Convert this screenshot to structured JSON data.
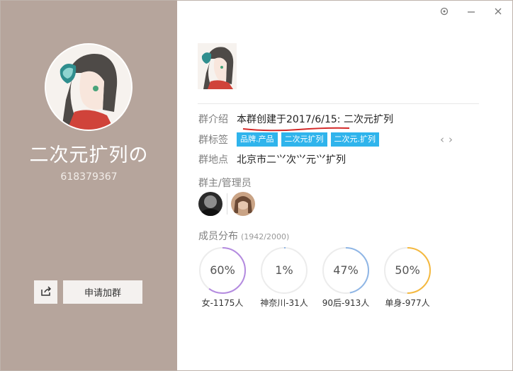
{
  "profile": {
    "name": "二次元扩列の",
    "id": "618379367",
    "join_label": "申请加群"
  },
  "info": {
    "intro_label": "群介绍",
    "intro_value": "本群创建于2017/6/15:  二次元扩列",
    "tags_label": "群标签",
    "tags": [
      "品牌.产品",
      "二次元扩列",
      "二次元.扩列"
    ],
    "location_label": "群地点",
    "location_value": "北京市二⺍次⺍元⺍扩列"
  },
  "admins": {
    "label": "群主/管理员"
  },
  "distribution": {
    "label": "成员分布",
    "count": "(1942/2000)",
    "items": [
      {
        "pct": "60%",
        "value": 60,
        "caption": "女-1175人",
        "color": "#b48be0"
      },
      {
        "pct": "1%",
        "value": 1,
        "caption": "神奈川-31人",
        "color": "#8fb6e6"
      },
      {
        "pct": "47%",
        "value": 47,
        "caption": "90后-913人",
        "color": "#8fb6e6"
      },
      {
        "pct": "50%",
        "value": 50,
        "caption": "单身-977人",
        "color": "#f5b93f"
      }
    ]
  },
  "colors": {
    "left_panel": "#b6a59c",
    "tag": "#2fb4ec"
  }
}
